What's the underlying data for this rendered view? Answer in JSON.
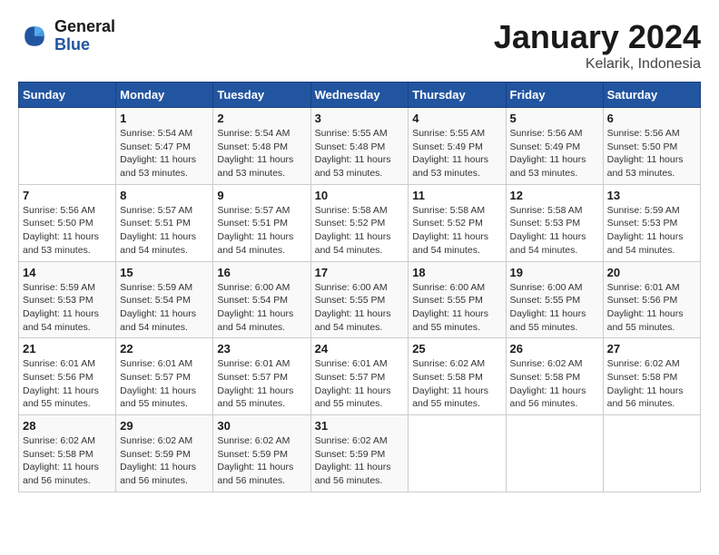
{
  "header": {
    "logo_line1": "General",
    "logo_line2": "Blue",
    "month_title": "January 2024",
    "location": "Kelarik, Indonesia"
  },
  "columns": [
    "Sunday",
    "Monday",
    "Tuesday",
    "Wednesday",
    "Thursday",
    "Friday",
    "Saturday"
  ],
  "weeks": [
    [
      {
        "day": "",
        "info": ""
      },
      {
        "day": "1",
        "info": "Sunrise: 5:54 AM\nSunset: 5:47 PM\nDaylight: 11 hours\nand 53 minutes."
      },
      {
        "day": "2",
        "info": "Sunrise: 5:54 AM\nSunset: 5:48 PM\nDaylight: 11 hours\nand 53 minutes."
      },
      {
        "day": "3",
        "info": "Sunrise: 5:55 AM\nSunset: 5:48 PM\nDaylight: 11 hours\nand 53 minutes."
      },
      {
        "day": "4",
        "info": "Sunrise: 5:55 AM\nSunset: 5:49 PM\nDaylight: 11 hours\nand 53 minutes."
      },
      {
        "day": "5",
        "info": "Sunrise: 5:56 AM\nSunset: 5:49 PM\nDaylight: 11 hours\nand 53 minutes."
      },
      {
        "day": "6",
        "info": "Sunrise: 5:56 AM\nSunset: 5:50 PM\nDaylight: 11 hours\nand 53 minutes."
      }
    ],
    [
      {
        "day": "7",
        "info": "Sunrise: 5:56 AM\nSunset: 5:50 PM\nDaylight: 11 hours\nand 53 minutes."
      },
      {
        "day": "8",
        "info": "Sunrise: 5:57 AM\nSunset: 5:51 PM\nDaylight: 11 hours\nand 54 minutes."
      },
      {
        "day": "9",
        "info": "Sunrise: 5:57 AM\nSunset: 5:51 PM\nDaylight: 11 hours\nand 54 minutes."
      },
      {
        "day": "10",
        "info": "Sunrise: 5:58 AM\nSunset: 5:52 PM\nDaylight: 11 hours\nand 54 minutes."
      },
      {
        "day": "11",
        "info": "Sunrise: 5:58 AM\nSunset: 5:52 PM\nDaylight: 11 hours\nand 54 minutes."
      },
      {
        "day": "12",
        "info": "Sunrise: 5:58 AM\nSunset: 5:53 PM\nDaylight: 11 hours\nand 54 minutes."
      },
      {
        "day": "13",
        "info": "Sunrise: 5:59 AM\nSunset: 5:53 PM\nDaylight: 11 hours\nand 54 minutes."
      }
    ],
    [
      {
        "day": "14",
        "info": "Sunrise: 5:59 AM\nSunset: 5:53 PM\nDaylight: 11 hours\nand 54 minutes."
      },
      {
        "day": "15",
        "info": "Sunrise: 5:59 AM\nSunset: 5:54 PM\nDaylight: 11 hours\nand 54 minutes."
      },
      {
        "day": "16",
        "info": "Sunrise: 6:00 AM\nSunset: 5:54 PM\nDaylight: 11 hours\nand 54 minutes."
      },
      {
        "day": "17",
        "info": "Sunrise: 6:00 AM\nSunset: 5:55 PM\nDaylight: 11 hours\nand 54 minutes."
      },
      {
        "day": "18",
        "info": "Sunrise: 6:00 AM\nSunset: 5:55 PM\nDaylight: 11 hours\nand 55 minutes."
      },
      {
        "day": "19",
        "info": "Sunrise: 6:00 AM\nSunset: 5:55 PM\nDaylight: 11 hours\nand 55 minutes."
      },
      {
        "day": "20",
        "info": "Sunrise: 6:01 AM\nSunset: 5:56 PM\nDaylight: 11 hours\nand 55 minutes."
      }
    ],
    [
      {
        "day": "21",
        "info": "Sunrise: 6:01 AM\nSunset: 5:56 PM\nDaylight: 11 hours\nand 55 minutes."
      },
      {
        "day": "22",
        "info": "Sunrise: 6:01 AM\nSunset: 5:57 PM\nDaylight: 11 hours\nand 55 minutes."
      },
      {
        "day": "23",
        "info": "Sunrise: 6:01 AM\nSunset: 5:57 PM\nDaylight: 11 hours\nand 55 minutes."
      },
      {
        "day": "24",
        "info": "Sunrise: 6:01 AM\nSunset: 5:57 PM\nDaylight: 11 hours\nand 55 minutes."
      },
      {
        "day": "25",
        "info": "Sunrise: 6:02 AM\nSunset: 5:58 PM\nDaylight: 11 hours\nand 55 minutes."
      },
      {
        "day": "26",
        "info": "Sunrise: 6:02 AM\nSunset: 5:58 PM\nDaylight: 11 hours\nand 56 minutes."
      },
      {
        "day": "27",
        "info": "Sunrise: 6:02 AM\nSunset: 5:58 PM\nDaylight: 11 hours\nand 56 minutes."
      }
    ],
    [
      {
        "day": "28",
        "info": "Sunrise: 6:02 AM\nSunset: 5:58 PM\nDaylight: 11 hours\nand 56 minutes."
      },
      {
        "day": "29",
        "info": "Sunrise: 6:02 AM\nSunset: 5:59 PM\nDaylight: 11 hours\nand 56 minutes."
      },
      {
        "day": "30",
        "info": "Sunrise: 6:02 AM\nSunset: 5:59 PM\nDaylight: 11 hours\nand 56 minutes."
      },
      {
        "day": "31",
        "info": "Sunrise: 6:02 AM\nSunset: 5:59 PM\nDaylight: 11 hours\nand 56 minutes."
      },
      {
        "day": "",
        "info": ""
      },
      {
        "day": "",
        "info": ""
      },
      {
        "day": "",
        "info": ""
      }
    ]
  ]
}
